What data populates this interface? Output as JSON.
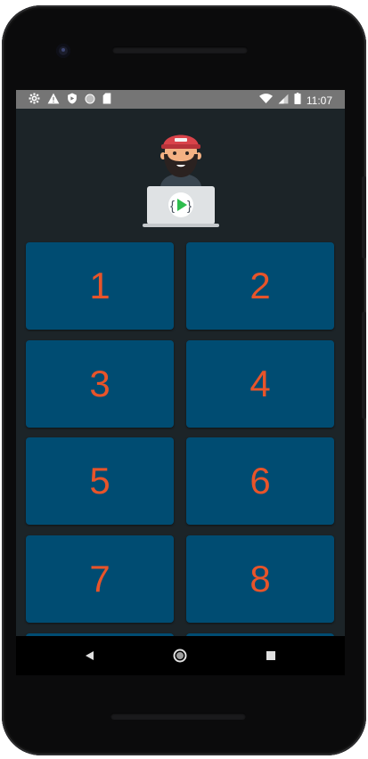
{
  "status_bar": {
    "time": "11:07",
    "left_icons": [
      "settings-icon",
      "warning-icon",
      "shield-icon",
      "circle-icon",
      "sd-card-icon"
    ],
    "right_icons": [
      "wifi-icon",
      "signal-icon",
      "battery-icon"
    ]
  },
  "header": {
    "logo": "developer-avatar-logo"
  },
  "tiles": [
    {
      "label": "1"
    },
    {
      "label": "2"
    },
    {
      "label": "3"
    },
    {
      "label": "4"
    },
    {
      "label": "5"
    },
    {
      "label": "6"
    },
    {
      "label": "7"
    },
    {
      "label": "8"
    }
  ],
  "nav_bar": {
    "back": "back-icon",
    "home": "home-icon",
    "recents": "recents-icon"
  },
  "colors": {
    "screen_background": "#1c2428",
    "tile_background": "#004c72",
    "tile_text": "#e8542a",
    "status_bar": "#757575"
  }
}
